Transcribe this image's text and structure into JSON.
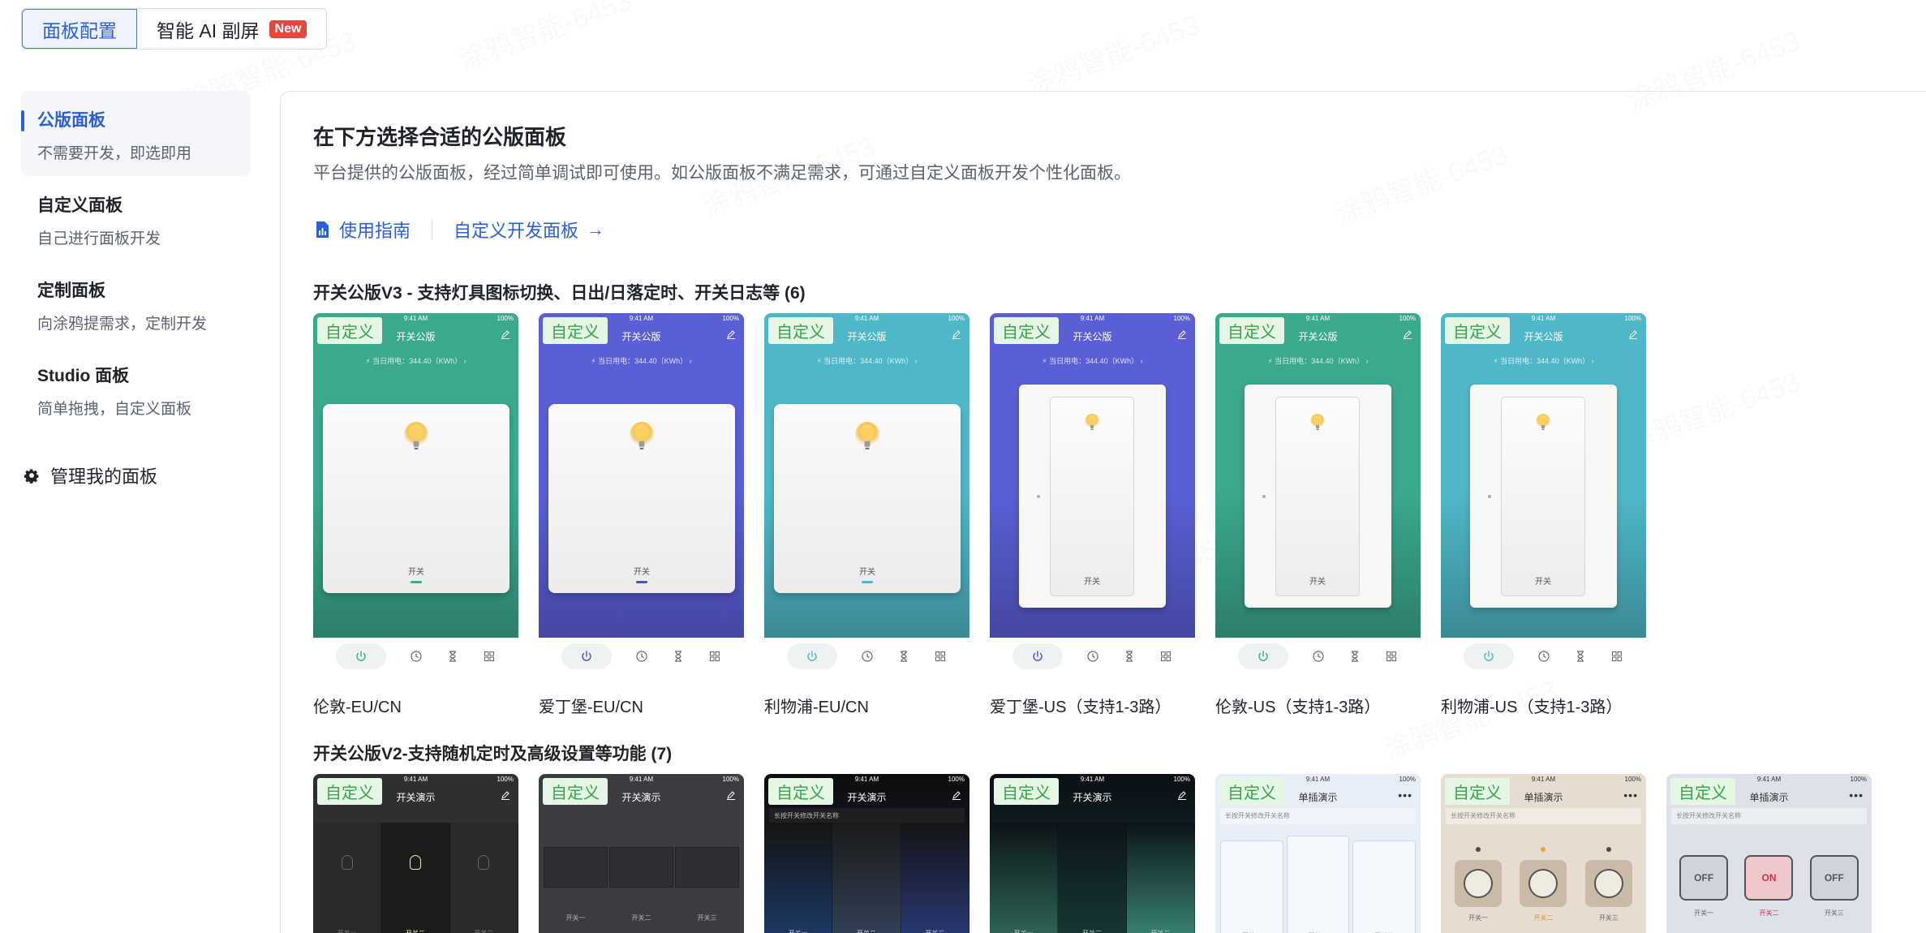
{
  "top_tabs": [
    {
      "label": "面板配置",
      "active": true
    },
    {
      "label": "智能 AI 副屏",
      "badge": "New"
    }
  ],
  "sidebar": {
    "items": [
      {
        "title": "公版面板",
        "desc": "不需要开发，即选即用",
        "active": true
      },
      {
        "title": "自定义面板",
        "desc": "自己进行面板开发"
      },
      {
        "title": "定制面板",
        "desc": "向涂鸦提需求，定制开发"
      },
      {
        "title": "Studio 面板",
        "desc": "简单拖拽，自定义面板"
      }
    ],
    "manage_label": "管理我的面板"
  },
  "main": {
    "title": "在下方选择合适的公版面板",
    "subtitle": "平台提供的公版面板，经过简单调试即可使用。如公版面板不满足需求，可通过自定义面板开发个性化面板。",
    "guide_link": "使用指南",
    "custom_dev_link": "自定义开发面板",
    "custom_dev_arrow": "→"
  },
  "thumb_text": {
    "custom_tag": "自定义",
    "time": "9:41 AM",
    "battery": "100%",
    "panel_title_v3": "开关公版",
    "power_line": "⚡ 当日用电：344.40（KWh） ›",
    "switch_label": "开关",
    "panel_title_v2_a": "开关演示",
    "panel_title_v2_b": "单插演示",
    "rename_hint": "长按开关修改开关名称",
    "col1": "开关一",
    "col2": "开关二",
    "col3": "开关三",
    "off": "OFF",
    "on": "ON"
  },
  "sections": [
    {
      "title": "开关公版V3 - 支持灯具图标切换、日出/日落定时、开关日志等 (6)",
      "cards": [
        {
          "name": "伦敦-EU/CN",
          "style": "eu",
          "bg": "#3aa98d",
          "accent": "#3aa98d"
        },
        {
          "name": "爱丁堡-EU/CN",
          "style": "eu",
          "bg": "#5a5fd6",
          "accent": "#4a4fc6"
        },
        {
          "name": "利物浦-EU/CN",
          "style": "eu",
          "bg": "#4fb8c8",
          "accent": "#4fb8c8"
        },
        {
          "name": "爱丁堡-US（支持1-3路）",
          "style": "us",
          "bg": "#5a5fd6",
          "accent": "#4a4fc6"
        },
        {
          "name": "伦敦-US（支持1-3路）",
          "style": "us",
          "bg": "#3aa98d",
          "accent": "#3aa98d"
        },
        {
          "name": "利物浦-US（支持1-3路）",
          "style": "us",
          "bg": "#4fb8c8",
          "accent": "#4fb8c8"
        }
      ]
    },
    {
      "title": "开关公版V2-支持随机定时及高级设置等功能 (7)",
      "cards": [
        {
          "style": "dark1"
        },
        {
          "style": "dark2"
        },
        {
          "style": "night"
        },
        {
          "style": "aurora"
        },
        {
          "style": "light"
        },
        {
          "style": "beige"
        },
        {
          "style": "grey"
        }
      ]
    }
  ],
  "colors": {
    "primary": "#2b5fd9",
    "custom_tag_text": "#35a44a",
    "custom_tag_bg": "#e5f6e5",
    "badge": "#e5463d"
  },
  "watermark": "涂鸦智能-6453"
}
